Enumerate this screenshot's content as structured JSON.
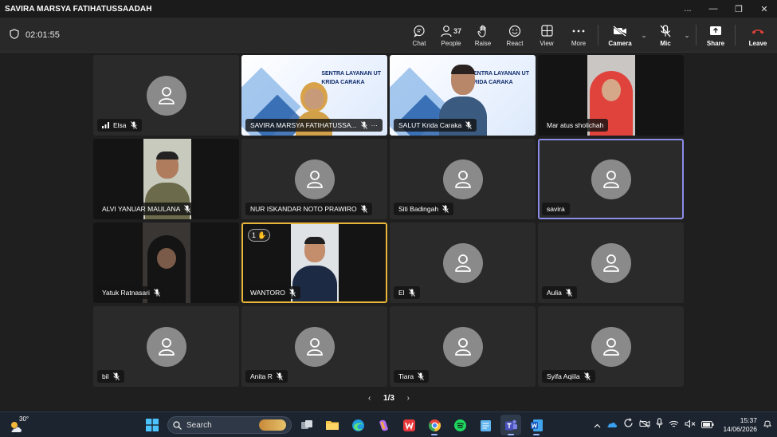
{
  "window": {
    "title": "SAVIRA MARSYA FATIHATUSSAADAH",
    "more_label": "...",
    "minimize_label": "—",
    "restore_label": "❐",
    "close_label": "✕"
  },
  "meeting": {
    "timer": "02:01:55"
  },
  "toolbar": {
    "chat_label": "Chat",
    "people_label": "People",
    "people_count": "37",
    "raise_label": "Raise",
    "react_label": "React",
    "view_label": "View",
    "more_label": "More",
    "camera_label": "Camera",
    "mic_label": "Mic",
    "share_label": "Share",
    "leave_label": "Leave"
  },
  "colors": {
    "selected_outline": "#8b8ce8",
    "raised_hand_outline": "#e8b53a",
    "leave_red": "#e0403a"
  },
  "participants": [
    {
      "name": "Elsa",
      "signal": true,
      "video": false
    },
    {
      "name": "SAVIRA MARSYA FATIHATUSSA...",
      "video": true,
      "slide": true,
      "more": "···"
    },
    {
      "name": "SALUT Krida Caraka",
      "video": true,
      "slide": true
    },
    {
      "name": "Mar atus sholichah",
      "video": true
    },
    {
      "name": "ALVI YANUAR MAULANA",
      "video": true
    },
    {
      "name": "NUR ISKANDAR NOTO PRAWIRO",
      "video": false
    },
    {
      "name": "Siti Badingah",
      "video": false
    },
    {
      "name": "savira",
      "video": false,
      "selected": true
    },
    {
      "name": "Yatuk Ratnasari",
      "video": true
    },
    {
      "name": "WANTORO",
      "video": true,
      "raised_hand": "1"
    },
    {
      "name": "El",
      "video": false
    },
    {
      "name": "Aulia",
      "video": false
    },
    {
      "name": "bil",
      "video": false
    },
    {
      "name": "Anita R",
      "video": false
    },
    {
      "name": "Tiara",
      "video": false
    },
    {
      "name": "Syifa Aqiila",
      "video": false
    }
  ],
  "slide": {
    "line1": "SENTRA LAYANAN UT",
    "line2": "KRIDA CARAKA"
  },
  "pagination": {
    "label": "1/3",
    "prev": "‹",
    "next": "›"
  },
  "taskbar": {
    "weather_temp": "30°",
    "search_placeholder": "Search",
    "clock_time": "15:37",
    "clock_date": "14/06/2026",
    "icons": [
      "task-view",
      "file-explorer",
      "edge",
      "copilot",
      "wps",
      "chrome",
      "spotify",
      "notepad",
      "teams",
      "word"
    ]
  }
}
